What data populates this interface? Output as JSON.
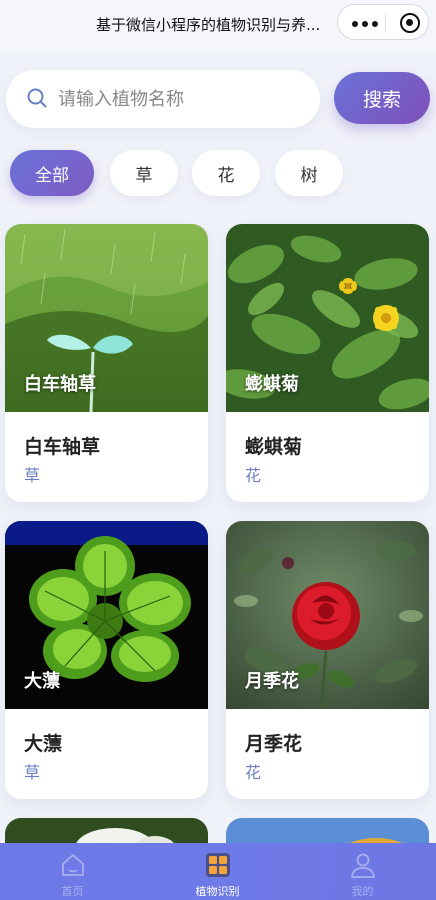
{
  "navbar": {
    "title": "基于微信小程序的植物识别与养..."
  },
  "search": {
    "placeholder": "请输入植物名称",
    "button_label": "搜索"
  },
  "filters": {
    "chips": [
      "全部",
      "草",
      "花",
      "树"
    ],
    "active": "全部"
  },
  "plants": [
    {
      "name": "白车轴草",
      "category": "草",
      "image": "seedling-in-rain"
    },
    {
      "name": "蟛蜞菊",
      "category": "花",
      "image": "yellow-daisy-leaves"
    },
    {
      "name": "大薸",
      "category": "草",
      "image": "water-lettuce"
    },
    {
      "name": "月季花",
      "category": "花",
      "image": "red-rose"
    }
  ],
  "tabbar": {
    "items": [
      {
        "label": "首页",
        "icon": "home-icon"
      },
      {
        "label": "植物识别",
        "icon": "grid-icon",
        "active": true
      },
      {
        "label": "我的",
        "icon": "user-icon"
      }
    ]
  },
  "colors": {
    "accent_start": "#6a72d9",
    "accent_end": "#7f4fb8",
    "category_text": "#6b7fc4",
    "tabbar": "#6e7ae8",
    "background": "#f0f2f9"
  }
}
